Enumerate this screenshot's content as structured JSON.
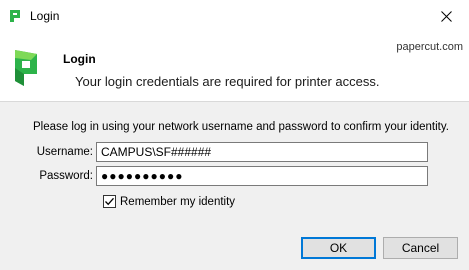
{
  "window": {
    "title": "Login",
    "brand_color": "#2db34a"
  },
  "header": {
    "title": "Login",
    "subtitle": "Your login credentials are required for printer access.",
    "brand": "papercut.com"
  },
  "form": {
    "instructions": "Please log in using your network username and password to confirm your identity.",
    "username_label": "Username:",
    "username_value": "CAMPUS\\SF######",
    "password_label": "Password:",
    "password_value": "●●●●●●●●●●",
    "remember_label": "Remember my identity",
    "remember_checked": true
  },
  "buttons": {
    "ok": "OK",
    "cancel": "Cancel"
  }
}
